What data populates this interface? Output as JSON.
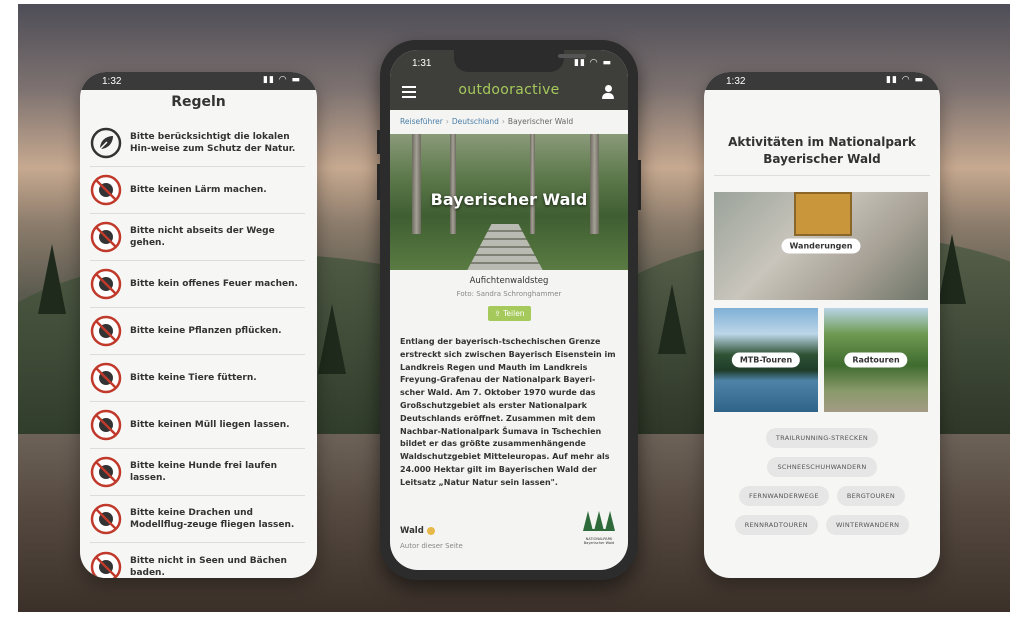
{
  "left_phone": {
    "time": "1:32",
    "title": "Regeln",
    "rules": [
      {
        "icon": "leaf-icon",
        "text": "Bitte berücksichtigt die lokalen Hin-weise zum Schutz der Natur."
      },
      {
        "icon": "no-noise-icon",
        "text": "Bitte keinen Lärm machen."
      },
      {
        "icon": "no-offtrail-icon",
        "text": "Bitte nicht abseits der Wege gehen."
      },
      {
        "icon": "no-fire-icon",
        "text": "Bitte kein offenes Feuer machen."
      },
      {
        "icon": "no-picking-plants-icon",
        "text": "Bitte keine Pflanzen pflücken."
      },
      {
        "icon": "no-feeding-animals-icon",
        "text": "Bitte keine Tiere füttern."
      },
      {
        "icon": "no-litter-icon",
        "text": "Bitte keinen Müll liegen lassen."
      },
      {
        "icon": "no-dogs-off-leash-icon",
        "text": "Bitte keine Hunde frei laufen lassen."
      },
      {
        "icon": "no-drones-icon",
        "text": "Bitte keine Drachen und Modellflug-zeuge fliegen lassen."
      },
      {
        "icon": "no-swimming-icon",
        "text": "Bitte nicht in Seen und Bächen baden."
      }
    ]
  },
  "center_phone": {
    "time": "1:31",
    "brand": "outdooractive",
    "breadcrumb": [
      "Reiseführer",
      "Deutschland",
      "Bayerischer Wald"
    ],
    "hero_title": "Bayerischer Wald",
    "image_caption": "Aufichtenwaldsteg",
    "image_credit": "Foto: Sandra Schronghammer",
    "share_label": "⇪ Teilen",
    "body": "Entlang der bayerisch-tschechischen Grenze erstreckt sich zwischen Bayerisch Eisenstein im Landkreis Regen und Mauth im Landkreis Freyung-Grafenau der Nationalpark Bayeri-scher Wald. Am 7. Oktober 1970 wurde das Großschutzgebiet als erster Nationalpark Deutschlands eröffnet. Zusammen mit dem Nachbar-Nationalpark Šumava in Tschechien bildet er das größte zusammenhängende Waldschutzgebiet Mitteleuropas. Auf mehr als 24.000 Hektar gilt im Bayerischen Wald der Leitsatz „Natur Natur sein lassen\".",
    "author_name": "Wald",
    "author_role": "Autor dieser Seite",
    "logo_caption": "NATIONALPARK Bayerischer Wald"
  },
  "right_phone": {
    "time": "1:32",
    "title": "Aktivitäten im Nationalpark Bayerischer Wald",
    "tiles": {
      "hike": "Wanderungen",
      "mtb": "MTB-Touren",
      "bike": "Radtouren"
    },
    "chips": [
      [
        "TRAILRUNNING-STRECKEN"
      ],
      [
        "SCHNEESCHUHWANDERN"
      ],
      [
        "FERNWANDERWEGE",
        "BERGTOUREN"
      ],
      [
        "RENNRADTOUREN",
        "WINTERWANDERN"
      ]
    ]
  },
  "colors": {
    "brand_green": "#a5c95a",
    "link_blue": "#4a7ea8",
    "rule_red": "#c0392b",
    "appbar_dark": "#3e3e3b"
  }
}
